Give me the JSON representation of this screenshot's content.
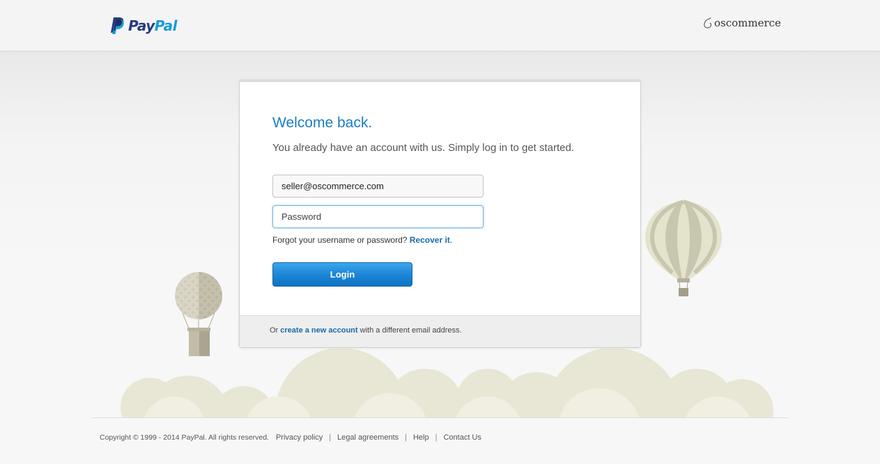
{
  "header": {
    "paypal_logo": {
      "pay": "Pay",
      "pal": "Pal",
      "icon": "paypal-p-icon",
      "colors": {
        "pay": "#253b80",
        "pal": "#179bd7"
      }
    },
    "partner_logo": {
      "text": "oscommerce",
      "icon": "oscommerce-swirl-icon"
    }
  },
  "login_card": {
    "heading": "Welcome back.",
    "subtitle": "You already have an account with us. Simply log in to get started.",
    "email_value": "seller@oscommerce.com",
    "password_placeholder": "Password",
    "forgot_text": "Forgot your username or password? ",
    "recover_link": "Recover it",
    "forgot_suffix": ".",
    "login_button": "Login",
    "footer_prefix": "Or ",
    "create_account_link": "create a new account",
    "footer_suffix": " with a different email address."
  },
  "footer": {
    "copyright": "Copyright © 1999 - 2014 PayPal. All rights reserved.",
    "links": [
      "Privacy policy",
      "Legal agreements",
      "Help",
      "Contact Us"
    ],
    "separator": "|"
  },
  "colors": {
    "accent_blue": "#1a7ec5",
    "link_blue": "#1a6ba8",
    "button_blue": "#1d86d6",
    "background": "#f6f6f6"
  }
}
